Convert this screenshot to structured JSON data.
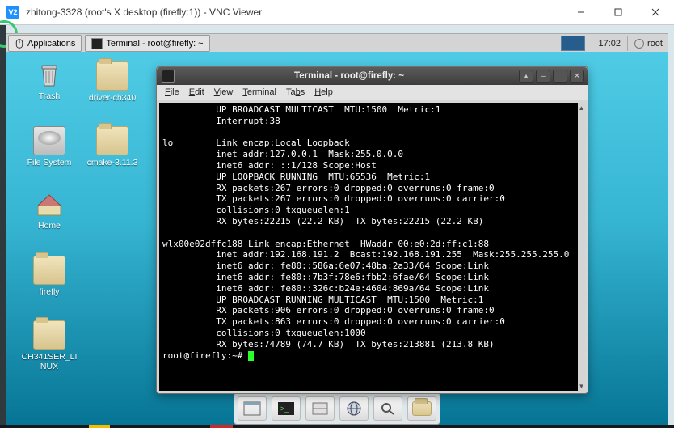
{
  "win": {
    "app_badge": "V2",
    "title": "zhitong-3328 (root's X desktop (firefly:1)) - VNC Viewer"
  },
  "panel": {
    "apps_label": "Applications",
    "task_label": "Terminal - root@firefly: ~",
    "time": "17:02",
    "user": "root"
  },
  "desktop_icons": {
    "trash": "Trash",
    "driver": "driver-ch340",
    "filesystem": "File System",
    "cmake": "cmake-3.11.3",
    "home": "Home",
    "firefly": "firefly",
    "ch341": "CH341SER_LI\nNUX"
  },
  "terminal": {
    "title": "Terminal - root@firefly: ~",
    "menu": {
      "file": "File",
      "edit": "Edit",
      "view": "View",
      "terminal": "Terminal",
      "tabs": "Tabs",
      "help": "Help"
    },
    "output": "          UP BROADCAST MULTICAST  MTU:1500  Metric:1\n          Interrupt:38\n\nlo        Link encap:Local Loopback\n          inet addr:127.0.0.1  Mask:255.0.0.0\n          inet6 addr: ::1/128 Scope:Host\n          UP LOOPBACK RUNNING  MTU:65536  Metric:1\n          RX packets:267 errors:0 dropped:0 overruns:0 frame:0\n          TX packets:267 errors:0 dropped:0 overruns:0 carrier:0\n          collisions:0 txqueuelen:1\n          RX bytes:22215 (22.2 KB)  TX bytes:22215 (22.2 KB)\n\nwlx00e02dffc188 Link encap:Ethernet  HWaddr 00:e0:2d:ff:c1:88\n          inet addr:192.168.191.2  Bcast:192.168.191.255  Mask:255.255.255.0\n          inet6 addr: fe80::586a:6e07:48ba:2a33/64 Scope:Link\n          inet6 addr: fe80::7b3f:78e6:fbb2:6fae/64 Scope:Link\n          inet6 addr: fe80::326c:b24e:4604:869a/64 Scope:Link\n          UP BROADCAST RUNNING MULTICAST  MTU:1500  Metric:1\n          RX packets:906 errors:0 dropped:0 overruns:0 frame:0\n          TX packets:863 errors:0 dropped:0 overruns:0 carrier:0\n          collisions:0 txqueuelen:1000\n          RX bytes:74789 (74.7 KB)  TX bytes:213881 (213.8 KB)\n",
    "prompt": "root@firefly:~# "
  }
}
